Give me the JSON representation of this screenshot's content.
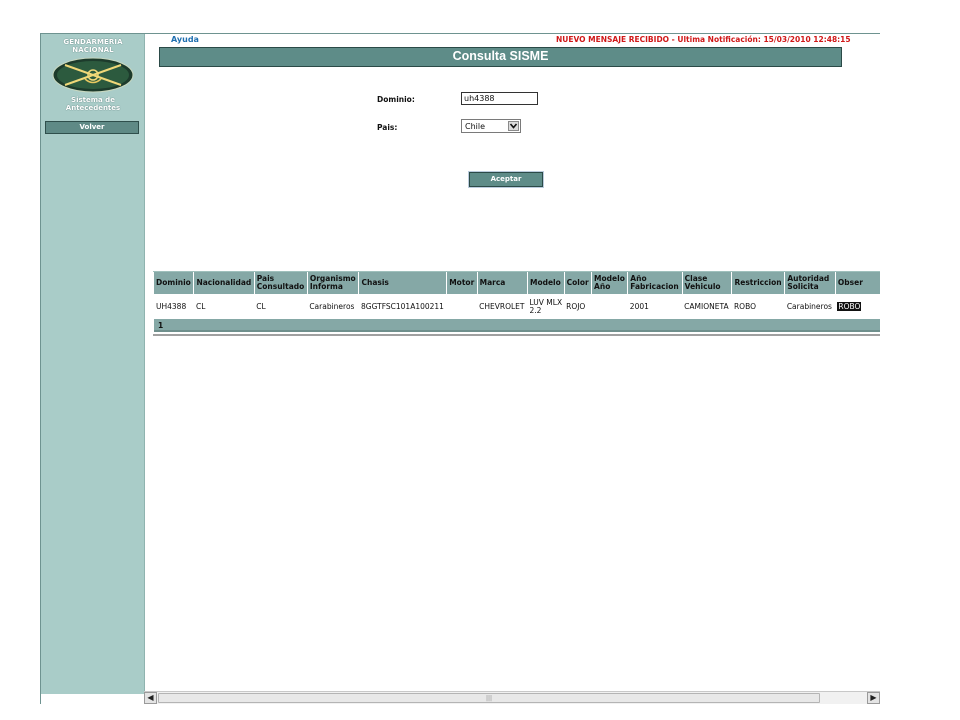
{
  "sidebar": {
    "logo_line1": "GENDARMERIA",
    "logo_line2": "NACIONAL",
    "system_line1": "Sistema de",
    "system_line2": "Antecedentes",
    "volver_label": "Volver"
  },
  "header": {
    "help_link": "Ayuda",
    "notification": "NUEVO MENSAJE RECIBIDO - Ultima Notificación: 15/03/2010 12:48:15",
    "page_title": "Consulta SISME"
  },
  "form": {
    "dominio_label": "Dominio:",
    "dominio_value": "uh4388",
    "pais_label": "Pais:",
    "pais_selected": "Chile",
    "submit_label": "Aceptar"
  },
  "results": {
    "columns": [
      "Dominio",
      "Nacionalidad",
      "Pais Consultado",
      "Organismo Informa",
      "Chasis",
      "Motor",
      "Marca",
      "Modelo",
      "Color",
      "Modelo Año",
      "Año Fabricacion",
      "Clase Vehiculo",
      "Restriccion",
      "Autoridad Solicita",
      "Obser"
    ],
    "rows": [
      [
        "UH4388",
        "CL",
        "CL",
        "Carabineros",
        "8GGTFSC101A100211",
        "",
        "CHEVROLET",
        "LUV MLX 2.2",
        "ROJO",
        "",
        "2001",
        "CAMIONETA",
        "ROBO",
        "Carabineros",
        "ROBO"
      ]
    ],
    "page": "1"
  },
  "colors": {
    "accent": "#5e8c88",
    "sidebar_bg": "#a9ccc8",
    "table_header_bg": "#85a8a6",
    "notification_text": "#d01818",
    "link": "#1e6fb0"
  }
}
